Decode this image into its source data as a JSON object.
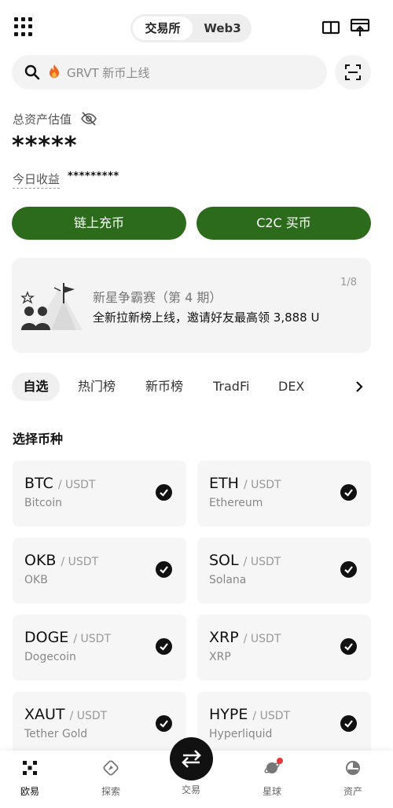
{
  "header": {
    "segments": [
      {
        "label": "交易所",
        "active": true
      },
      {
        "label": "Web3",
        "active": false
      }
    ]
  },
  "search": {
    "placeholder": "GRVT 新币上线",
    "icon": "fire-icon"
  },
  "assets": {
    "total_label": "总资产估值",
    "total_value": "*****",
    "today_label": "今日收益",
    "today_value": "*********"
  },
  "actions": {
    "deposit_label": "链上充币",
    "c2c_label": "C2C 买币",
    "accent": "#2d6b1c"
  },
  "banner": {
    "title": "新星争霸赛（第 4 期）",
    "subtitle": "全新拉新榜上线，邀请好友最高领 3,888 U",
    "page": "1/8"
  },
  "categories": [
    {
      "label": "自选",
      "active": true
    },
    {
      "label": "热门榜",
      "active": false
    },
    {
      "label": "新币榜",
      "active": false
    },
    {
      "label": "TradFi",
      "active": false
    },
    {
      "label": "DEX",
      "active": false
    }
  ],
  "section_title": "选择币种",
  "coins": [
    {
      "symbol": "BTC",
      "quote": "/ USDT",
      "name": "Bitcoin",
      "selected": true
    },
    {
      "symbol": "ETH",
      "quote": "/ USDT",
      "name": "Ethereum",
      "selected": true
    },
    {
      "symbol": "OKB",
      "quote": "/ USDT",
      "name": "OKB",
      "selected": true
    },
    {
      "symbol": "SOL",
      "quote": "/ USDT",
      "name": "Solana",
      "selected": true
    },
    {
      "symbol": "DOGE",
      "quote": "/ USDT",
      "name": "Dogecoin",
      "selected": true
    },
    {
      "symbol": "XRP",
      "quote": "/ USDT",
      "name": "XRP",
      "selected": true
    },
    {
      "symbol": "XAUT",
      "quote": "/ USDT",
      "name": "Tether Gold",
      "selected": true
    },
    {
      "symbol": "HYPE",
      "quote": "/ USDT",
      "name": "Hyperliquid",
      "selected": true
    }
  ],
  "bottom_nav": [
    {
      "label": "欧易",
      "icon": "okx-logo-icon",
      "active": true
    },
    {
      "label": "探索",
      "icon": "compass-icon",
      "active": false
    },
    {
      "label": "交易",
      "icon": "swap-arrows-icon",
      "active": false
    },
    {
      "label": "星球",
      "icon": "planet-icon",
      "active": false
    },
    {
      "label": "资产",
      "icon": "pie-chart-icon",
      "active": false
    }
  ]
}
